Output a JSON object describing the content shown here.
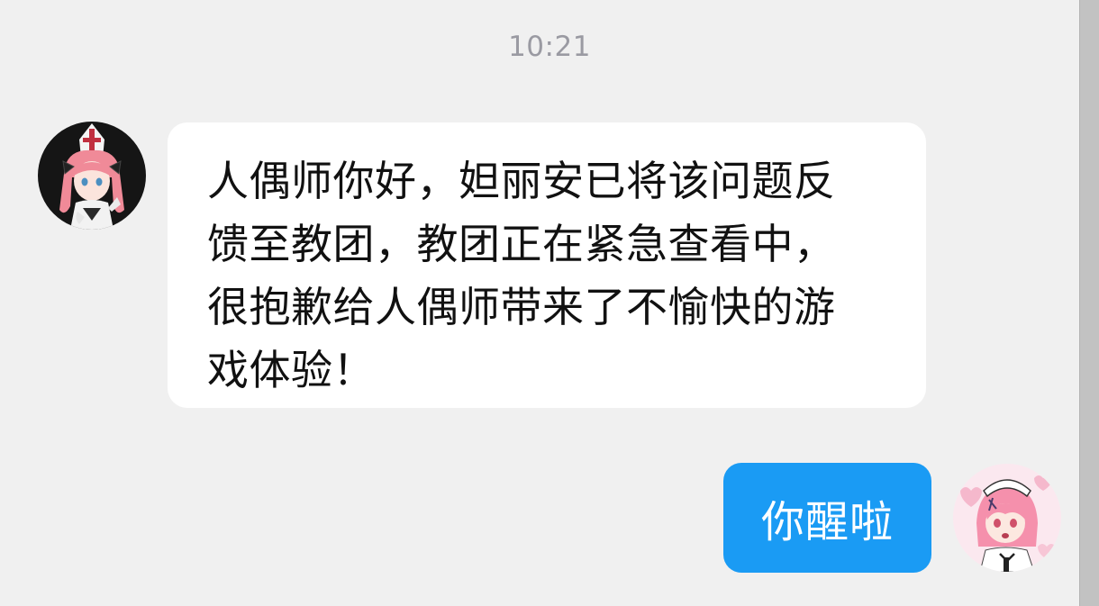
{
  "chat": {
    "timestamp": "10:21",
    "messages": [
      {
        "direction": "incoming",
        "text": "人偶师你好，妲丽安已将该问题反馈至教团，教团正在紧急查看中，很抱歉给人偶师带来了不愉快的游戏体验！"
      },
      {
        "direction": "outgoing",
        "text": "你醒啦"
      }
    ]
  },
  "colors": {
    "background": "#f0f0f0",
    "incoming_bubble": "#ffffff",
    "outgoing_bubble": "#1a9bf4",
    "timestamp_text": "#9a9aa2"
  },
  "icons": {
    "left_avatar": "anime-character-avatar",
    "right_avatar": "anime-character-avatar"
  }
}
